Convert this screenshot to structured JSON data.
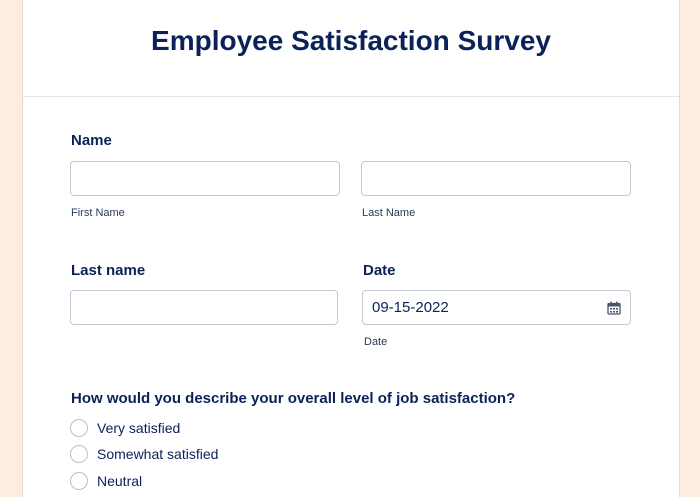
{
  "form": {
    "title": "Employee Satisfaction Survey",
    "name_field": {
      "label": "Name",
      "first_sublabel": "First Name",
      "last_sublabel": "Last Name",
      "first_value": "",
      "last_value": ""
    },
    "last_name_field": {
      "label": "Last name",
      "value": ""
    },
    "date_field": {
      "label": "Date",
      "value": "09-15-2022",
      "sublabel": "Date",
      "icon": "calendar-icon"
    },
    "question": {
      "text": "How would you describe your overall level of job satisfaction?",
      "options": [
        "Very satisfied",
        "Somewhat satisfied",
        "Neutral"
      ]
    }
  },
  "colors": {
    "page_background": "#fbeee0",
    "heading": "#0b2157",
    "input_border": "#c3c8d6"
  }
}
